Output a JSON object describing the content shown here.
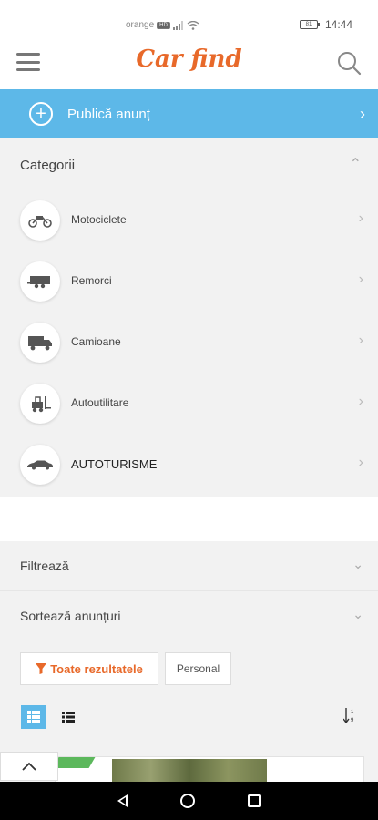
{
  "status": {
    "carrier": "orange",
    "carrier_tag": "HD",
    "battery": "81",
    "time": "14:44"
  },
  "header": {
    "logo": "Car find"
  },
  "publish": {
    "label": "Publică anunț"
  },
  "categories": {
    "title": "Categorii",
    "items": [
      {
        "label": "Motociclete",
        "icon": "motorcycle-icon"
      },
      {
        "label": "Remorci",
        "icon": "trailer-icon"
      },
      {
        "label": "Camioane",
        "icon": "truck-icon"
      },
      {
        "label": "Autoutilitare",
        "icon": "forklift-icon"
      },
      {
        "label": "AUTOTURISME",
        "icon": "car-icon"
      }
    ]
  },
  "filter": {
    "label": "Filtrează"
  },
  "sort": {
    "label": "Sortează anunțuri"
  },
  "results": {
    "all_label": "Toate rezultatele",
    "personal_label": "Personal"
  },
  "colors": {
    "accent": "#5db8e8",
    "brand": "#e8692a"
  }
}
